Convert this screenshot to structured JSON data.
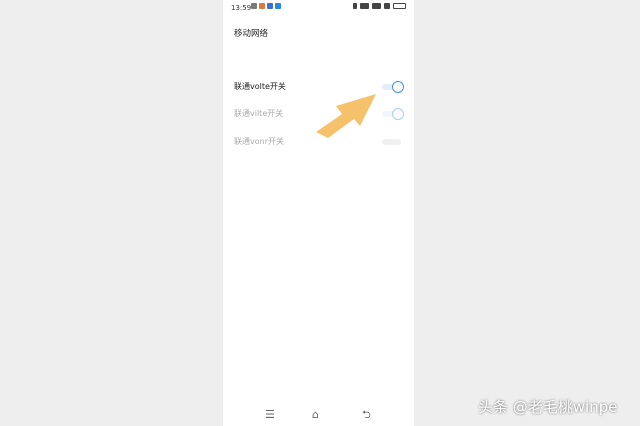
{
  "status_bar": {
    "time": "13:59"
  },
  "page": {
    "title": "移动网络"
  },
  "settings": [
    {
      "label": "联通volte开关",
      "state": "on",
      "enabled": true
    },
    {
      "label": "联通vilte开关",
      "state": "on",
      "enabled": false
    },
    {
      "label": "联通vonr开关",
      "state": "off",
      "enabled": false
    }
  ],
  "nav": {
    "menu_icon": "☰",
    "home_icon": "⌂",
    "back_icon": "⮌"
  },
  "annotation": {
    "arrow_color": "#f5c26b"
  },
  "watermark": "头条 @老毛桃winpe"
}
